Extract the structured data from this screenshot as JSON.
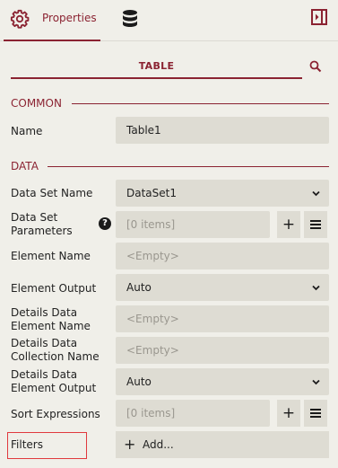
{
  "tabs": {
    "properties_label": "Properties",
    "data_icon": "database-icon",
    "properties_icon": "gear-icon",
    "collapse_icon": "collapse-panel-icon"
  },
  "title": "TABLE",
  "search_icon": "search-icon",
  "sections": {
    "common": "COMMON",
    "data": "DATA"
  },
  "common": {
    "name_label": "Name",
    "name_value": "Table1"
  },
  "data": {
    "dataset_name_label": "Data Set Name",
    "dataset_name_value": "DataSet1",
    "dataset_params_label": "Data Set Parameters",
    "dataset_params_value": "[0 items]",
    "help_glyph": "?",
    "element_name_label": "Element Name",
    "element_name_placeholder": "<Empty>",
    "element_output_label": "Element Output",
    "element_output_value": "Auto",
    "details_element_name_label": "Details Data Element Name",
    "details_element_name_placeholder": "<Empty>",
    "details_collection_name_label": "Details Data Collection Name",
    "details_collection_name_placeholder": "<Empty>",
    "details_element_output_label": "Details Data Element Output",
    "details_element_output_value": "Auto",
    "sort_expressions_label": "Sort Expressions",
    "sort_expressions_value": "[0 items]",
    "filters_label": "Filters",
    "filters_add": "Add...",
    "plus_glyph": "+"
  },
  "colors": {
    "accent": "#8b2332",
    "background": "#f0efe9",
    "field_bg": "#dedcd3",
    "highlight_border": "#e0393e"
  }
}
